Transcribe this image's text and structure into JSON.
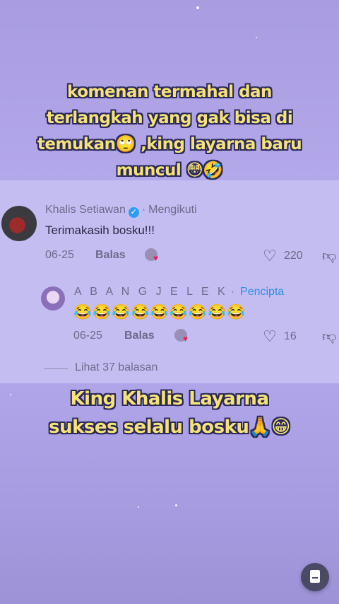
{
  "overlay": {
    "top_caption": [
      "komenan termahal dan",
      "terlangkah yang gak bisa di",
      "temukan🙄 ,king layarna baru",
      "muncul 😳🤣"
    ],
    "bottom_caption": [
      "King Khalis Layarna",
      "sukses selalu bosku🙏😁"
    ]
  },
  "comment": {
    "author": "Khalis Setiawan",
    "separator": "·",
    "follow_status": "Mengikuti",
    "text": "Terimakasih bosku!!!",
    "date": "06-25",
    "reply_label": "Balas",
    "like_count": "220"
  },
  "reply": {
    "author": "A B A N G J E L E K",
    "separator": "·",
    "badge": "Pencipta",
    "text": "😂😂😂😂😂😂😂😂😂",
    "date": "06-25",
    "reply_label": "Balas",
    "like_count": "16"
  },
  "view_replies": "Lihat 37 balasan",
  "colors": {
    "caption": "#f6e27a",
    "creator_badge": "#2d8fe0",
    "verified": "#2d9cf0"
  },
  "icons": [
    "verified-icon",
    "heart-icon",
    "dislike-icon",
    "notes-icon"
  ]
}
